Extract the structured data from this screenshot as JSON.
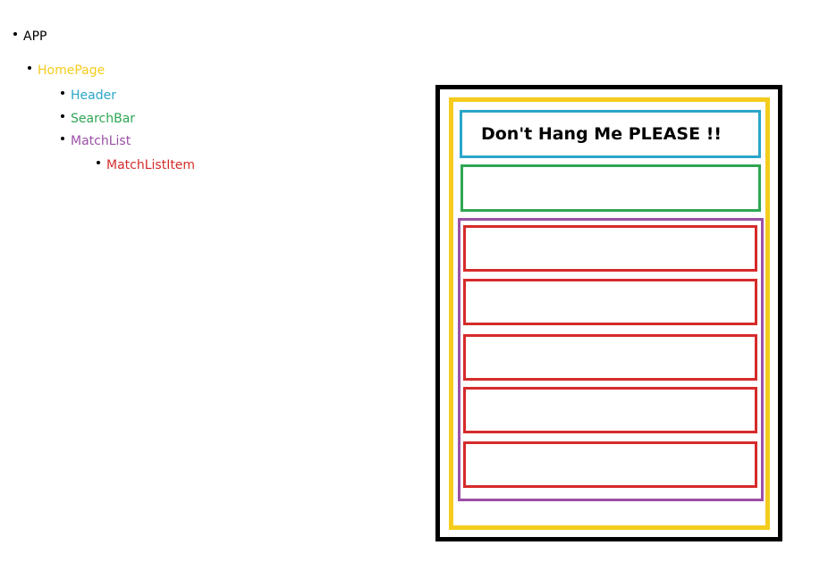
{
  "tree": {
    "app": {
      "label": "APP",
      "color": "#000000"
    },
    "homepage": {
      "label": "HomePage",
      "color": "#f5cc1d"
    },
    "header": {
      "label": "Header",
      "color": "#2aa6c9"
    },
    "searchbar": {
      "label": "SearchBar",
      "color": "#2ea653"
    },
    "matchlist": {
      "label": "MatchList",
      "color": "#9b4fa6"
    },
    "matchlistitem": {
      "label": "MatchListItem",
      "color": "#d62b2b"
    }
  },
  "wireframe": {
    "header_text": "Don't Hang Me PLEASE !!",
    "match_item_count": 5,
    "colors": {
      "outer": "#000000",
      "homepage": "#f5cc1d",
      "header": "#2aa6c9",
      "searchbar": "#2ea653",
      "matchlist": "#9b4fa6",
      "matchlistitem": "#d62b2b"
    }
  }
}
